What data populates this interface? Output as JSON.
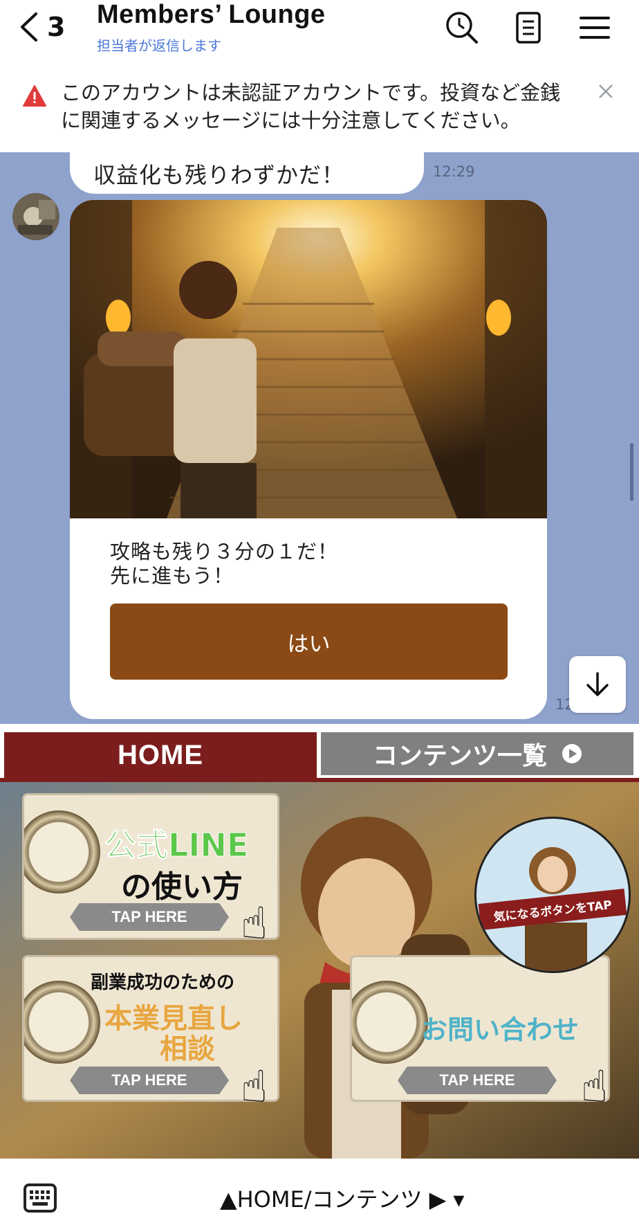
{
  "header": {
    "back_count": "3",
    "title": "Members’ Lounge",
    "subtitle": "担当者が返信します",
    "icons": [
      "search-history-icon",
      "notes-icon",
      "menu-icon"
    ]
  },
  "notice": {
    "text": "このアカウントは未認証アカウントです。投資など金銭に関連するメッセージには十分注意してください。",
    "close_icon": "close-icon"
  },
  "chat": {
    "prev_message_tail": "収益化も残りわずかだ！",
    "prev_time": "12:29",
    "card": {
      "image": "adventurer climbing glowing stairs",
      "line1": "攻略も残り３分の１だ！",
      "line2": "先に進もう！",
      "button_label": "はい"
    },
    "card_time": "12"
  },
  "rich_menu": {
    "tab_home": "HOME",
    "tab_content": "コンテンツ一覧",
    "panel1": {
      "line1": "公式LINE",
      "line2": "の使い方",
      "tap": "TAP HERE"
    },
    "panel2": {
      "line1": "副業成功のための",
      "line2": "本業見直し",
      "line3": "相談",
      "tap": "TAP HERE"
    },
    "panel3": {
      "line1": "お問い合わせ",
      "tap": "TAP HERE"
    },
    "circle_label": "気になるボタンをTAP"
  },
  "bottom_bar": {
    "menu_label": "▲HOME/コンテンツ ▶︎ ▾",
    "keyboard_icon": "keyboard-icon"
  },
  "colors": {
    "chat_bg": "#8ea2cc",
    "button": "#8b4a15",
    "tab_active": "#7c1d1d",
    "tab_inactive": "#808080",
    "link_blue": "#4a77d8"
  }
}
